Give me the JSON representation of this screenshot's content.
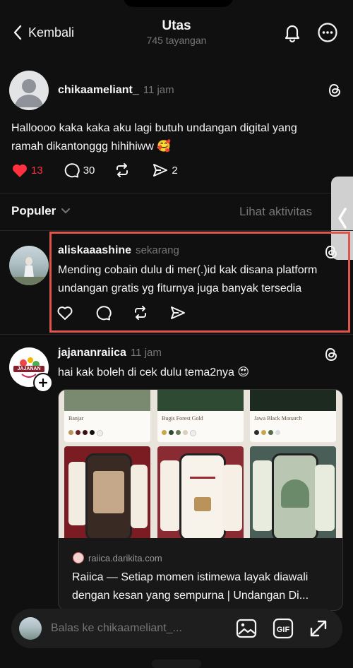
{
  "header": {
    "back_label": "Kembali",
    "title": "Utas",
    "subtitle": "745 tayangan"
  },
  "op": {
    "username": "chikaameliant_",
    "time": "11 jam",
    "text_line1": "Halloooo kaka kaka aku lagi butuh undangan digital yang",
    "text_line2": "ramah dikantonggg hihihiww 🥰",
    "likes": "13",
    "comments": "30",
    "shares": "2"
  },
  "sort": {
    "label": "Populer",
    "activity_link": "Lihat aktivitas"
  },
  "reply1": {
    "username": "aliskaaashine",
    "time": "sekarang",
    "text_line1": "Mending cobain dulu di mer(.)id kak disana platform",
    "text_line2": "undangan gratis yg fiturnya juga banyak tersedia"
  },
  "reply2": {
    "username": "jajananraiica",
    "time": "11 jam",
    "text": "hai kak boleh di cek dulu tema2nya 😍",
    "link_domain": "raiica.darikita.com",
    "link_title_line1": "Raiica — Setiap momen istimewa layak diawali",
    "link_title_line2": "dengan kesan yang sempurna | Undangan Di...",
    "themes": [
      "Banjar",
      "Bugis Forest Gold",
      "Jawa Black Monarch"
    ],
    "avatar_text": "JAJANAN"
  },
  "composer": {
    "placeholder": "Balas ke chikaameliant_..."
  },
  "colors": {
    "background": "#101010",
    "highlight_border": "#e0554a",
    "like_red": "#ff3040"
  }
}
